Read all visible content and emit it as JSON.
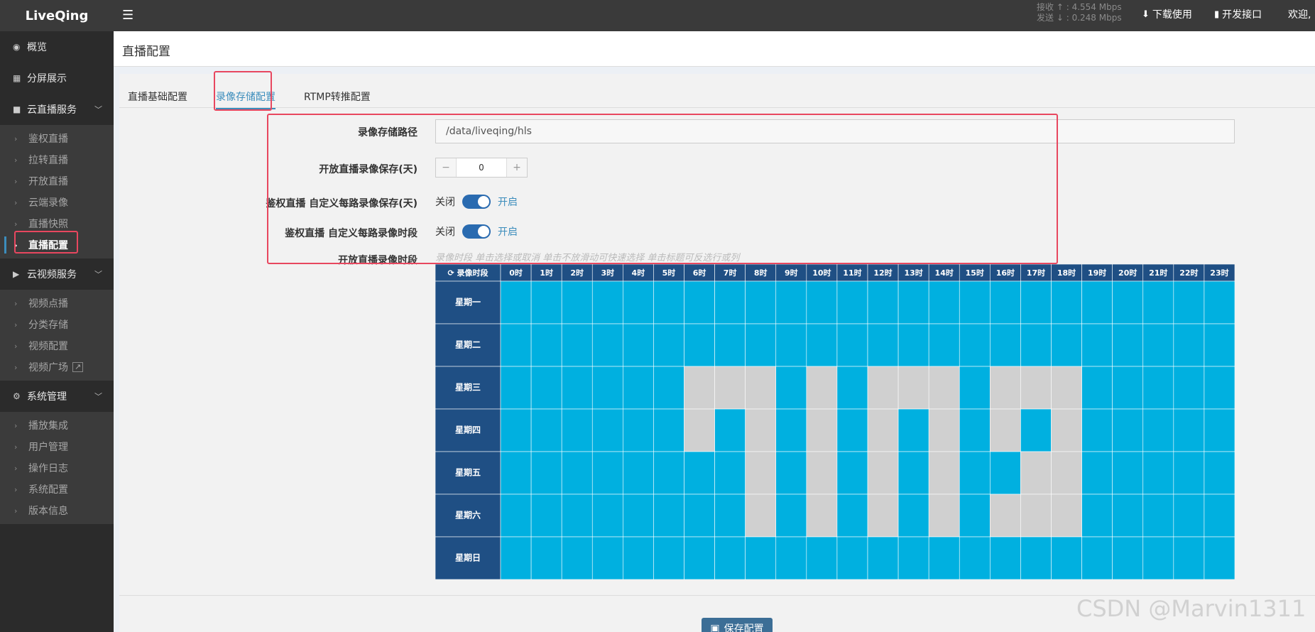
{
  "topbar": {
    "brand": "LiveQing",
    "rate_rx_label": "接收",
    "rate_rx_value": "4.554 Mbps",
    "rate_tx_label": "发送",
    "rate_tx_value": "0.248 Mbps",
    "download_label": "下载使用",
    "api_label": "开发接口",
    "welcome_label": "欢迎,"
  },
  "sidebar": {
    "overview": "概览",
    "split_screen": "分屏展示",
    "cloud_live": "云直播服务",
    "cloud_live_items": [
      "鉴权直播",
      "拉转直播",
      "开放直播",
      "云端录像",
      "直播快照",
      "直播配置"
    ],
    "cloud_video": "云视频服务",
    "cloud_video_items": [
      "视频点播",
      "分类存储",
      "视频配置",
      "视频广场"
    ],
    "system": "系统管理",
    "system_items": [
      "播放集成",
      "用户管理",
      "操作日志",
      "系统配置",
      "版本信息"
    ]
  },
  "page": {
    "title": "直播配置",
    "tabs": [
      "直播基础配置",
      "录像存储配置",
      "RTMP转推配置"
    ]
  },
  "form": {
    "path_label": "录像存储路径",
    "path_value": "/data/liveqing/hls",
    "retain_label": "开放直播录像保存(天)",
    "retain_value": "0",
    "stepper_minus": "−",
    "stepper_plus": "+",
    "custom_retain_label": "鉴权直播 自定义每路录像保存(天)",
    "custom_period_label": "鉴权直播 自定义每路录像时段",
    "switch_off": "关闭",
    "switch_on": "开启",
    "open_period_label": "开放直播录像时段",
    "hint": "录像时段 单击选择或取消 单击不放滑动可快速选择 单击标题可反选行或列",
    "save_label": "保存配置"
  },
  "schedule": {
    "corner_label": "录像时段",
    "hours": [
      "0时",
      "1时",
      "2时",
      "3时",
      "4时",
      "5时",
      "6时",
      "7时",
      "8时",
      "9时",
      "10时",
      "11时",
      "12时",
      "13时",
      "14时",
      "15时",
      "16时",
      "17时",
      "18时",
      "19时",
      "20时",
      "21时",
      "22时",
      "23时"
    ],
    "days": [
      "星期一",
      "星期二",
      "星期三",
      "星期四",
      "星期五",
      "星期六",
      "星期日"
    ],
    "on_color": "#00b0e0",
    "off_color": "#d0d0d0",
    "header_color": "#1f4f84",
    "off_cells": [
      [
        2,
        6
      ],
      [
        2,
        7
      ],
      [
        2,
        8
      ],
      [
        2,
        10
      ],
      [
        2,
        12
      ],
      [
        2,
        13
      ],
      [
        2,
        14
      ],
      [
        2,
        16
      ],
      [
        2,
        17
      ],
      [
        2,
        18
      ],
      [
        3,
        6
      ],
      [
        3,
        8
      ],
      [
        3,
        10
      ],
      [
        3,
        12
      ],
      [
        3,
        14
      ],
      [
        3,
        16
      ],
      [
        3,
        18
      ],
      [
        4,
        8
      ],
      [
        4,
        10
      ],
      [
        4,
        12
      ],
      [
        4,
        14
      ],
      [
        4,
        17
      ],
      [
        4,
        18
      ],
      [
        5,
        8
      ],
      [
        5,
        10
      ],
      [
        5,
        12
      ],
      [
        5,
        14
      ],
      [
        5,
        16
      ],
      [
        5,
        17
      ],
      [
        5,
        18
      ]
    ]
  },
  "watermark": "CSDN @Marvin1311"
}
